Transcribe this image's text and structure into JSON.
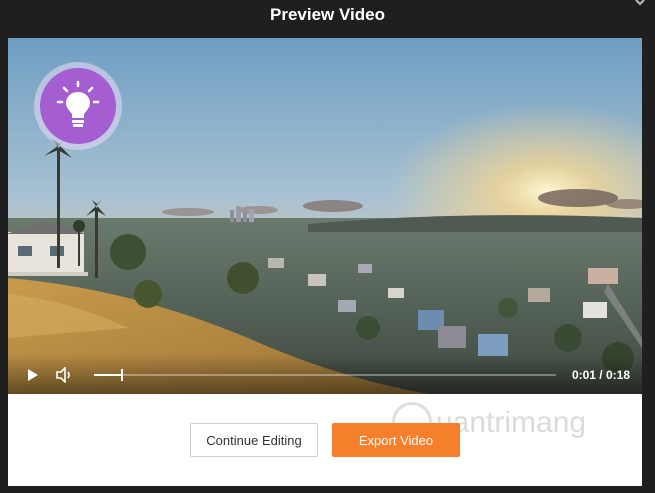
{
  "modal": {
    "title": "Preview Video"
  },
  "player": {
    "current_time": "0:01",
    "duration": "0:18",
    "time_text": "0:01 / 0:18",
    "progress_fraction": 0.06
  },
  "actions": {
    "continue_label": "Continue Editing",
    "export_label": "Export Video"
  },
  "watermark": {
    "text": "uantrimang"
  },
  "colors": {
    "export_accent": "#f57f2a",
    "badge_purple": "#a45ed2"
  },
  "icons": [
    "close-icon",
    "lightbulb-icon",
    "play-icon",
    "volume-icon"
  ]
}
